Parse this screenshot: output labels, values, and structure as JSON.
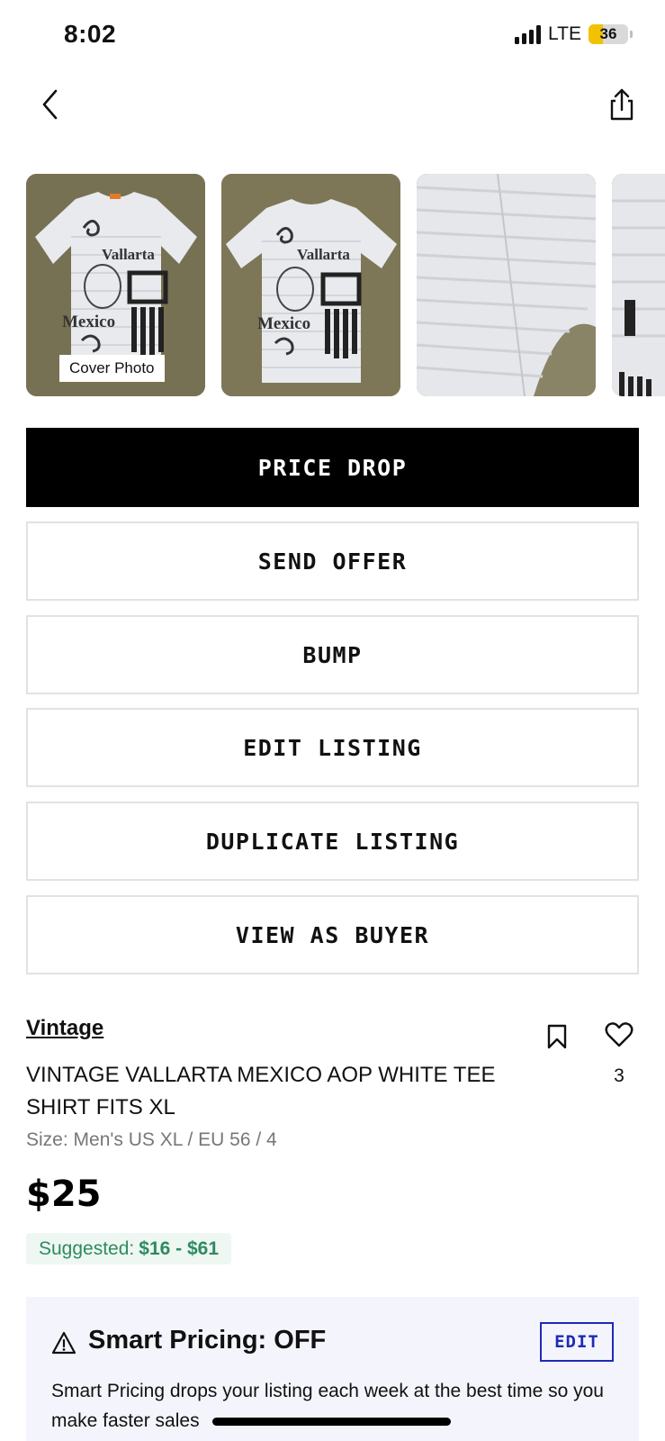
{
  "status_bar": {
    "time": "8:02",
    "network": "LTE",
    "battery": "36",
    "battery_level": 0.36,
    "battery_color": "#f2c200"
  },
  "nav": {
    "back_icon": "chevron-left-icon",
    "share_icon": "share-icon"
  },
  "gallery": {
    "cover_label": "Cover Photo",
    "photos": [
      {
        "label": "Vallarta México tee front"
      },
      {
        "label": "Vallarta México tee front"
      },
      {
        "label": "Tee fabric detail"
      },
      {
        "label": "Tee detail"
      }
    ]
  },
  "actions": {
    "price_drop": "PRICE DROP",
    "send_offer": "SEND OFFER",
    "bump": "BUMP",
    "edit_listing": "EDIT LISTING",
    "duplicate_listing": "DUPLICATE LISTING",
    "view_as_buyer": "VIEW AS BUYER"
  },
  "listing": {
    "brand": "Vintage",
    "title": "VINTAGE VALLARTA MEXICO AOP WHITE TEE SHIRT FITS XL",
    "size": "Size: Men's US XL / EU 56 / 4",
    "price": "$25",
    "suggested_label": "Suggested:",
    "suggested_range": "$16 - $61",
    "like_count": "3",
    "bookmark_icon": "bookmark-icon",
    "heart_icon": "heart-icon"
  },
  "smart_pricing": {
    "title": "Smart Pricing: OFF",
    "edit_label": "EDIT",
    "description": "Smart Pricing drops your listing each week at the best time so you make faster sales",
    "warning_icon": "warning-icon",
    "accent_color": "#1f2bb5"
  },
  "colors": {
    "primary_button": "#000000",
    "suggested_green": "#2f8a5f",
    "card_background": "#f4f5fc"
  }
}
